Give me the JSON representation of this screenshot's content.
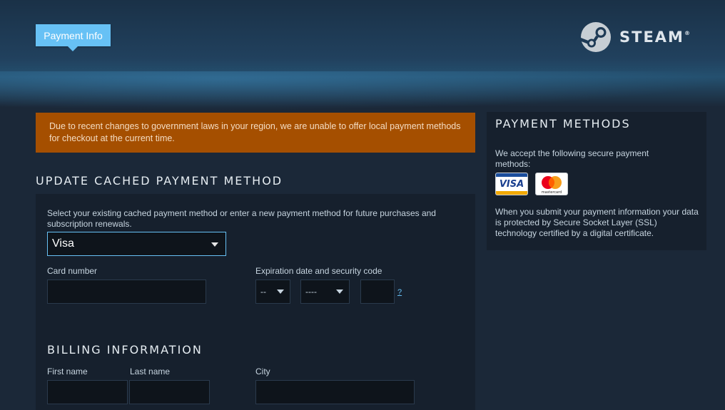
{
  "header": {
    "tab_label": "Payment Info",
    "logo_text": "STEAM",
    "logo_mark": "®"
  },
  "notice": {
    "text": "Due to recent changes to government laws in your region, we are unable to offer local payment methods for checkout at the current time."
  },
  "payment": {
    "title": "UPDATE CACHED PAYMENT METHOD",
    "description": "Select your existing cached payment method or enter a new payment method for future purchases and subscription renewals.",
    "method_selected": "Visa",
    "card_number_label": "Card number",
    "card_number_value": "",
    "expiration_label": "Expiration date and security code",
    "exp_month_value": "--",
    "exp_year_value": "----",
    "security_code_value": "",
    "help_link": "?"
  },
  "billing": {
    "title": "BILLING INFORMATION",
    "first_name_label": "First name",
    "last_name_label": "Last name",
    "city_label": "City",
    "first_name_value": "",
    "last_name_value": "",
    "city_value": ""
  },
  "sidebar": {
    "title": "PAYMENT METHODS",
    "accept_text": "We accept the following secure payment methods:",
    "cards": [
      "VISA",
      "mastercard"
    ],
    "ssl_text": "When you submit your payment information your data is protected by Secure Socket Layer (SSL) technology certified by a digital certificate."
  },
  "colors": {
    "background": "#1b2838",
    "accent": "#67c1f5",
    "notice": "#a54f00",
    "panel": "#16202d"
  }
}
